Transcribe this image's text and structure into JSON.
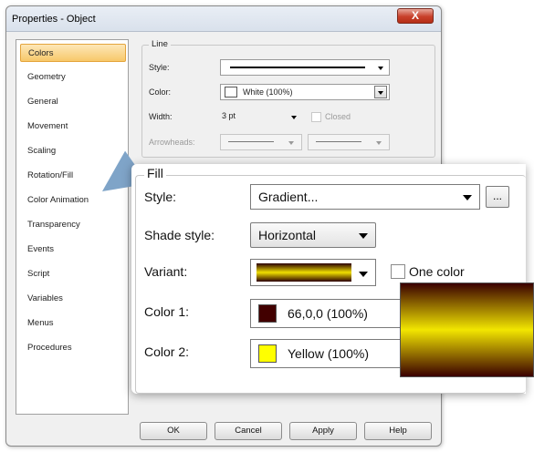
{
  "window": {
    "title": "Properties - Object",
    "close_label": "X"
  },
  "sidebar": {
    "items": [
      {
        "label": "Colors",
        "active": true
      },
      {
        "label": "Geometry"
      },
      {
        "label": "General"
      },
      {
        "label": "Movement"
      },
      {
        "label": "Scaling"
      },
      {
        "label": "Rotation/Fill"
      },
      {
        "label": "Color Animation"
      },
      {
        "label": "Transparency"
      },
      {
        "label": "Events"
      },
      {
        "label": "Script"
      },
      {
        "label": "Variables"
      },
      {
        "label": "Menus"
      },
      {
        "label": "Procedures"
      }
    ]
  },
  "line": {
    "legend": "Line",
    "style_label": "Style:",
    "color_label": "Color:",
    "color_value": "White (100%)",
    "width_label": "Width:",
    "width_value": "3 pt",
    "closed_label": "Closed",
    "arrowheads_label": "Arrowheads:"
  },
  "fill": {
    "legend": "Fill",
    "style_label": "Style:",
    "style_value": "Gradient...",
    "more_button": "...",
    "shade_label": "Shade style:",
    "shade_value": "Horizontal",
    "variant_label": "Variant:",
    "one_color_label": "One color",
    "color1_label": "Color 1:",
    "color1_value": "66,0,0 (100%)",
    "color1_hex": "#420000",
    "color2_label": "Color 2:",
    "color2_value": "Yellow (100%)",
    "color2_hex": "#ffff00"
  },
  "buttons": {
    "ok": "OK",
    "cancel": "Cancel",
    "apply": "Apply",
    "help": "Help"
  },
  "colors": {
    "accent_selected": "#f7c86a",
    "pointer": "#7fa4c8"
  }
}
